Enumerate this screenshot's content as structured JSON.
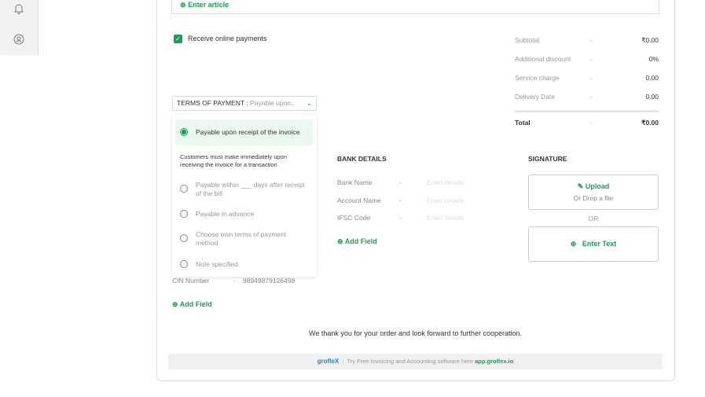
{
  "sidebar": {
    "icons": [
      "bell-icon",
      "user-circle-icon"
    ]
  },
  "article": {
    "enter_article": "Enter article"
  },
  "online_payments": {
    "label": "Receive online payments",
    "checked": true
  },
  "terms": {
    "label": "TERMS OF PAYMENT :",
    "value": "Payable upon..",
    "options": [
      {
        "label": "Payable upon receipt of the invoice",
        "selected": true
      },
      {
        "label": "Payable within ___ days after receipt of the bill",
        "selected": false
      },
      {
        "label": "Payable in advance",
        "selected": false
      },
      {
        "label": "Choose own terms of payment method",
        "selected": false
      },
      {
        "label": "Note specified",
        "selected": false
      }
    ],
    "description": "Customers must make immediately upon receiving the invoice for a transaction"
  },
  "company": {
    "cin_label": "CIN Number",
    "cin_sep": "-",
    "cin_value": "98949879126498",
    "add_field": "Add Field"
  },
  "totals": {
    "rows": [
      {
        "label": "Subtotal",
        "sep": "-",
        "value": "₹0.00"
      },
      {
        "label": "Additional discount",
        "sep": "-",
        "value": "0%"
      },
      {
        "label": "Service charge",
        "sep": "-",
        "value": "0.00"
      },
      {
        "label": "Delivery Date",
        "sep": "-",
        "value": "0.00"
      }
    ],
    "total_label": "Total",
    "total_sep": "-",
    "total_value": "₹0.00"
  },
  "bank": {
    "title": "BANK DETAILS",
    "rows": [
      {
        "label": "Bank Name",
        "sep": "-",
        "placeholder": "Enter details"
      },
      {
        "label": "Account Name",
        "sep": "-",
        "placeholder": "Enter details"
      },
      {
        "label": "IFSC Code",
        "sep": "-",
        "placeholder": "Enter details"
      }
    ],
    "add_field": "Add Field"
  },
  "signature": {
    "title": "SIGNATURE",
    "upload": "Upload",
    "drop": "Or Drop a file",
    "or": "OR",
    "enter_text": "Enter Text"
  },
  "footer": {
    "thanks": "We thank you for your order and look forward to further cooperation.",
    "logo": "grofleX",
    "promo": "Try Free Invoicing and Accounting software here",
    "link": "app.groflex.io"
  },
  "colors": {
    "accent": "#1aa053"
  }
}
